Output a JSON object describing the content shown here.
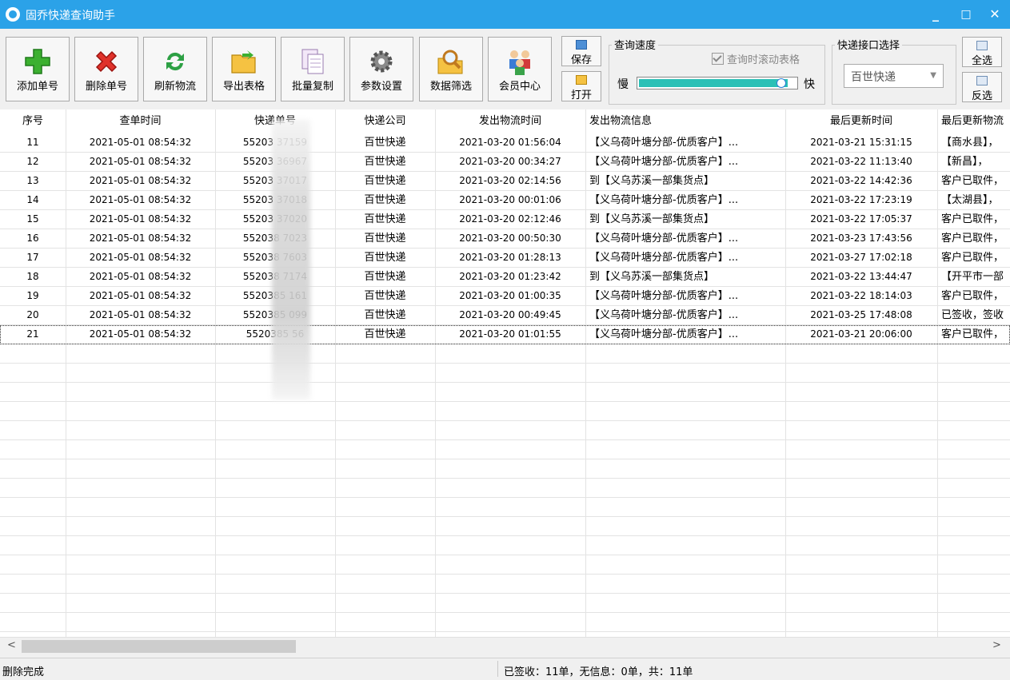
{
  "window": {
    "title": "固乔快递查询助手",
    "minimize": "_",
    "maximize": "□",
    "close": "✕"
  },
  "toolbar": {
    "buttons": [
      {
        "label": "添加单号",
        "icon": "plus-icon"
      },
      {
        "label": "删除单号",
        "icon": "delete-icon"
      },
      {
        "label": "刷新物流",
        "icon": "refresh-icon"
      },
      {
        "label": "导出表格",
        "icon": "folder-export-icon"
      },
      {
        "label": "批量复制",
        "icon": "copy-icon"
      },
      {
        "label": "参数设置",
        "icon": "gear-icon"
      },
      {
        "label": "数据筛选",
        "icon": "search-folder-icon"
      },
      {
        "label": "会员中心",
        "icon": "members-icon"
      }
    ],
    "save_label": "保存",
    "open_label": "打开"
  },
  "speed": {
    "group_title": "查询速度",
    "scroll_label": "查询时滚动表格",
    "scroll_checked": true,
    "slow": "慢",
    "fast": "快",
    "level": 0.95
  },
  "api": {
    "group_title": "快递接口选择",
    "selected": "百世快递"
  },
  "select": {
    "all": "全选",
    "invert": "反选"
  },
  "table": {
    "headers": [
      "序号",
      "查单时间",
      "快递单号",
      "快递公司",
      "发出物流时间",
      "发出物流信息",
      "最后更新时间",
      "最后更新物流"
    ],
    "rows": [
      [
        "11",
        "2021-05-01 08:54:32",
        "55203   37159",
        "百世快递",
        "2021-03-20 01:56:04",
        "【义乌荷叶塘分部-优质客户】...",
        "2021-03-21 15:31:15",
        "【商水县】，"
      ],
      [
        "12",
        "2021-05-01 08:54:32",
        "55203   36967",
        "百世快递",
        "2021-03-20 00:34:27",
        "【义乌荷叶塘分部-优质客户】...",
        "2021-03-22 11:13:40",
        "【新昌】，"
      ],
      [
        "13",
        "2021-05-01 08:54:32",
        "55203   37017",
        "百世快递",
        "2021-03-20 02:14:56",
        "到【义乌苏溪一部集货点】",
        "2021-03-22 14:42:36",
        "客户已取件，"
      ],
      [
        "14",
        "2021-05-01 08:54:32",
        "55203   37018",
        "百世快递",
        "2021-03-20 00:01:06",
        "【义乌荷叶塘分部-优质客户】...",
        "2021-03-22 17:23:19",
        "【太湖县】，"
      ],
      [
        "15",
        "2021-05-01 08:54:32",
        "55203   37020",
        "百世快递",
        "2021-03-20 02:12:46",
        "到【义乌苏溪一部集货点】",
        "2021-03-22 17:05:37",
        "客户已取件，"
      ],
      [
        "16",
        "2021-05-01 08:54:32",
        "552038   7023",
        "百世快递",
        "2021-03-20 00:50:30",
        "【义乌荷叶塘分部-优质客户】...",
        "2021-03-23 17:43:56",
        "客户已取件，"
      ],
      [
        "17",
        "2021-05-01 08:54:32",
        "552038   7603",
        "百世快递",
        "2021-03-20 01:28:13",
        "【义乌荷叶塘分部-优质客户】...",
        "2021-03-27 17:02:18",
        "客户已取件，"
      ],
      [
        "18",
        "2021-05-01 08:54:32",
        "552038   7174",
        "百世快递",
        "2021-03-20 01:23:42",
        "到【义乌苏溪一部集货点】",
        "2021-03-22 13:44:47",
        "【开平市一部"
      ],
      [
        "19",
        "2021-05-01 08:54:32",
        "5520385   161",
        "百世快递",
        "2021-03-20 01:00:35",
        "【义乌荷叶塘分部-优质客户】...",
        "2021-03-22 18:14:03",
        "客户已取件，"
      ],
      [
        "20",
        "2021-05-01 08:54:32",
        "5520385   099",
        "百世快递",
        "2021-03-20 00:49:45",
        "【义乌荷叶塘分部-优质客户】...",
        "2021-03-25 17:48:08",
        "已签收，签收"
      ],
      [
        "21",
        "2021-05-01 08:54:32",
        "5520385   56",
        "百世快递",
        "2021-03-20 01:01:55",
        "【义乌荷叶塘分部-优质客户】...",
        "2021-03-21 20:06:00",
        "客户已取件，"
      ]
    ]
  },
  "status": {
    "left": "删除完成",
    "summary": "已签收：11单，无信息：0单，共：11单"
  },
  "scrollbar": {
    "left_arrow": "<",
    "right_arrow": ">"
  }
}
